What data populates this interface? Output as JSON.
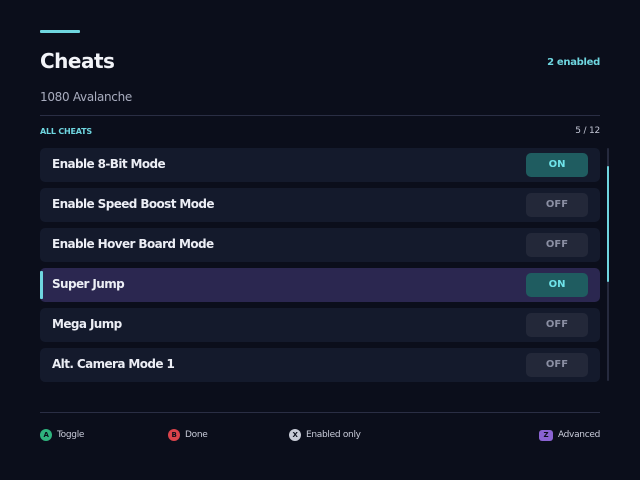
{
  "header": {
    "title": "Cheats",
    "enabled_count": "2 enabled",
    "game_name": "1080 Avalanche"
  },
  "section": {
    "label": "ALL CHEATS",
    "pager": "5 / 12"
  },
  "cheats": [
    {
      "label": "Enable 8-Bit Mode",
      "state": "ON"
    },
    {
      "label": "Enable Speed Boost Mode",
      "state": "OFF"
    },
    {
      "label": "Enable Hover Board Mode",
      "state": "OFF"
    },
    {
      "label": "Super Jump",
      "state": "ON"
    },
    {
      "label": "Mega Jump",
      "state": "OFF"
    },
    {
      "label": "Alt. Camera Mode 1",
      "state": "OFF"
    }
  ],
  "footer": {
    "a": {
      "glyph": "A",
      "label": "Toggle",
      "color": "#2fb37d"
    },
    "b": {
      "glyph": "B",
      "label": "Done",
      "color": "#d9434b"
    },
    "x": {
      "glyph": "X",
      "label": "Enabled only",
      "color": "#c8cbd6"
    },
    "z": {
      "glyph": "Z",
      "label": "Advanced",
      "color": "#8a63d2"
    }
  },
  "colors": {
    "accent": "#6fd6e0",
    "background": "#0b0e1b",
    "row_bg": "#141a2c",
    "row_selected_bg": "#2b2750",
    "toggle_on_bg": "#1f5c60",
    "toggle_off_bg": "#232839"
  }
}
